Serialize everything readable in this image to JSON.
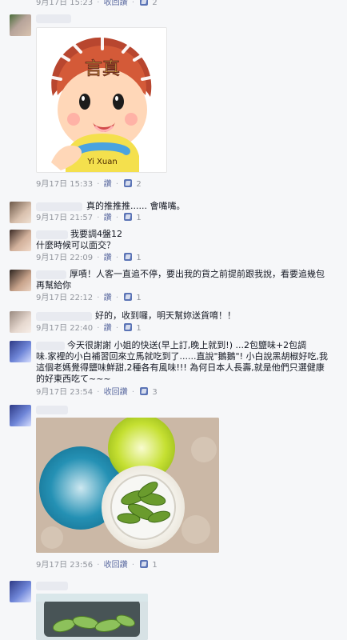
{
  "comments": [
    {
      "id": "c0",
      "meta": {
        "date_time": "9月17日 15:23",
        "reply": "收回讚",
        "likes": "2"
      }
    },
    {
      "id": "c1",
      "meta": {
        "date_time": "9月17日 15:33",
        "reply": "讚",
        "likes": "2"
      },
      "image": {
        "icon": "yi-xuan-cartoon",
        "brand": "Yi Xuan",
        "chinese_mark": "言真"
      }
    },
    {
      "id": "c2",
      "text": "真的推推推...... 會嘴嘴。",
      "meta": {
        "date_time": "9月17日 21:57",
        "reply": "讚",
        "likes": "1"
      }
    },
    {
      "id": "c3",
      "text": "我要調4盤12",
      "text_line2": "什麼時候可以面交？",
      "meta": {
        "date_time": "9月17日 22:09",
        "reply": "讚",
        "likes": "1"
      }
    },
    {
      "id": "c4",
      "text": "厚嘖！人客一直追不停，要出我的貨之前提前跟我說，看要追幾包",
      "text_line2": "再幫給你",
      "meta": {
        "date_time": "9月17日 22:12",
        "reply": "讚",
        "likes": "1"
      }
    },
    {
      "id": "c5",
      "text": "好的，收到囉，明天幫妳送貨唷！！",
      "meta": {
        "date_time": "9月17日 22:40",
        "reply": "讚",
        "likes": "1"
      }
    },
    {
      "id": "c6",
      "text_lines": [
        "今天很謝謝    小姐的快送(早上訂,晚上就到!) ...2包鹽味+2包調",
        "味.家裡的小白補習回來立馬就吃到了......直說\"鵝鵝\"! 小白說黑胡椒好吃,我",
        "這個老媽覺得鹽味鮮甜,2種各有風味!!! 為何日本人長壽,就是他們只選健康",
        "的好東西吃て~~~"
      ],
      "meta": {
        "date_time": "9月17日 23:54",
        "reply": "收回讚",
        "likes": "3"
      }
    },
    {
      "id": "c7",
      "meta": {
        "date_time": "9月17日 23:56",
        "reply": "收回讚",
        "likes": "1"
      },
      "image": {
        "icon": "edamame-plate-photo"
      }
    },
    {
      "id": "c8",
      "image": {
        "icon": "edamame-closeup-photo"
      }
    }
  ],
  "colors": {
    "background": "#f6f7f9",
    "meta_gray": "#90949c",
    "link_blue": "#5b6aa0",
    "like_blue": "#5b74b6"
  }
}
